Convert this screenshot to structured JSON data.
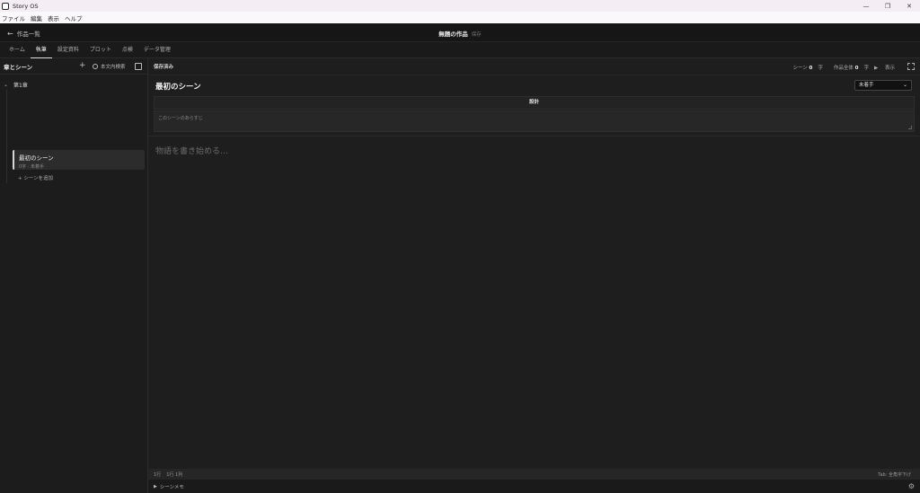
{
  "app": {
    "title": "Story OS"
  },
  "window": {
    "minimize": "—",
    "restore": "❐",
    "close": "✕"
  },
  "menu": {
    "items": [
      "ファイル",
      "編集",
      "表示",
      "ヘルプ"
    ]
  },
  "header": {
    "back_label": "作品一覧",
    "work_title": "無題の作品",
    "work_sub": "保存"
  },
  "tabs": [
    "ホーム",
    "執筆",
    "設定資料",
    "プロット",
    "点検",
    "データ管理"
  ],
  "sidebar": {
    "title": "章とシーン",
    "search_label": "本文内検索",
    "chapter": "第1章",
    "scene": {
      "name": "最初のシーン",
      "meta": "0字 · 未着手"
    },
    "add_scene": "シーンを追加"
  },
  "main": {
    "saved": "保存済み",
    "counts": {
      "scene_label": "シーン",
      "scene_value": "0",
      "scene_unit": "字",
      "work_label": "作品全体",
      "work_value": "0",
      "work_unit": "字",
      "display": "表示"
    },
    "scene_title": "最初のシーン",
    "status": "未着手",
    "design": "設計",
    "summary_placeholder": "このシーンのあらすじ",
    "editor_placeholder": "物語を書き始める…"
  },
  "status_bar": {
    "line": "1行",
    "position": "1行 1列",
    "hint": "Tab: 全角字下げ"
  },
  "memo": {
    "label": "シーンメモ"
  }
}
